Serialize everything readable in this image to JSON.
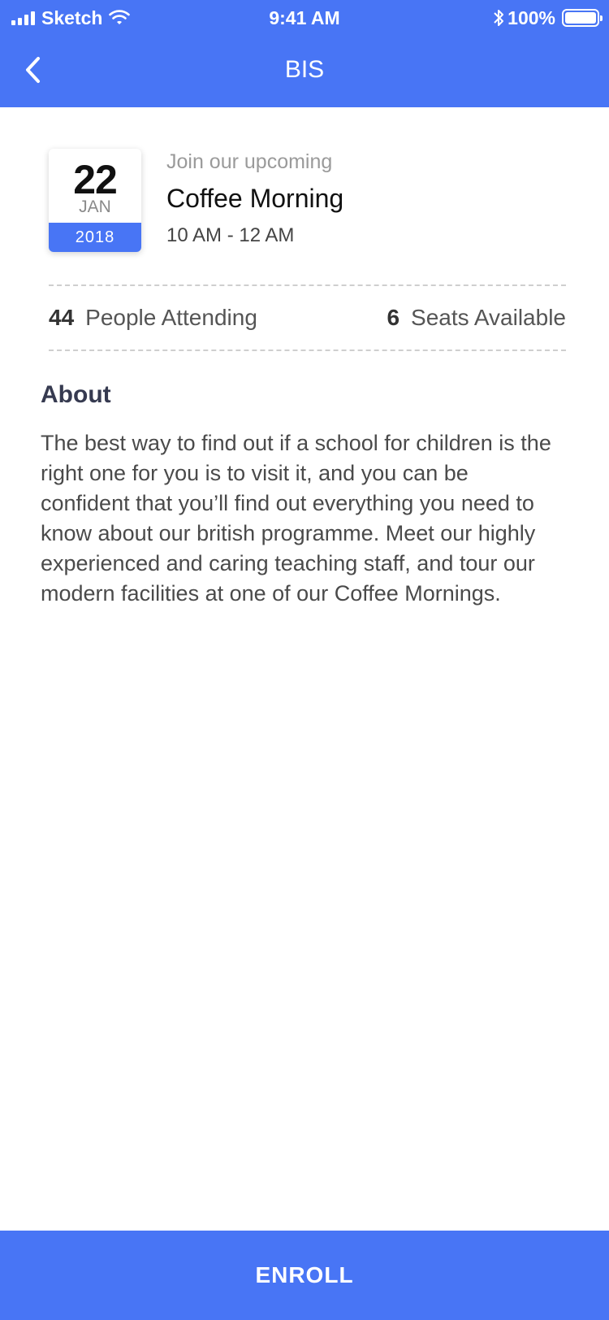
{
  "status_bar": {
    "carrier": "Sketch",
    "time": "9:41 AM",
    "battery": "100%",
    "icons": [
      "signal-icon",
      "wifi-icon",
      "bluetooth-icon",
      "battery-icon"
    ]
  },
  "nav": {
    "title": "BIS",
    "back_icon": "chevron-left-icon"
  },
  "event": {
    "date": {
      "day": "22",
      "month": "JAN",
      "year": "2018"
    },
    "kicker": "Join our upcoming",
    "title": "Coffee Morning",
    "time": "10 AM - 12 AM"
  },
  "stats": {
    "attending_count": "44",
    "attending_label": "People Attending",
    "seats_count": "6",
    "seats_label": "Seats Available"
  },
  "about": {
    "heading": "About",
    "body": "The best way to find out if a school for children is the right one for you is to visit it, and you can be confident that you’ll find out everything you need to know about our british programme. Meet our highly experienced and caring teaching staff, and tour our modern facilities at one of our Coffee Mornings."
  },
  "actions": {
    "enroll_label": "ENROLL"
  },
  "colors": {
    "accent": "#4875f5",
    "heading": "#363a50",
    "body_text": "#4a4a4a"
  }
}
